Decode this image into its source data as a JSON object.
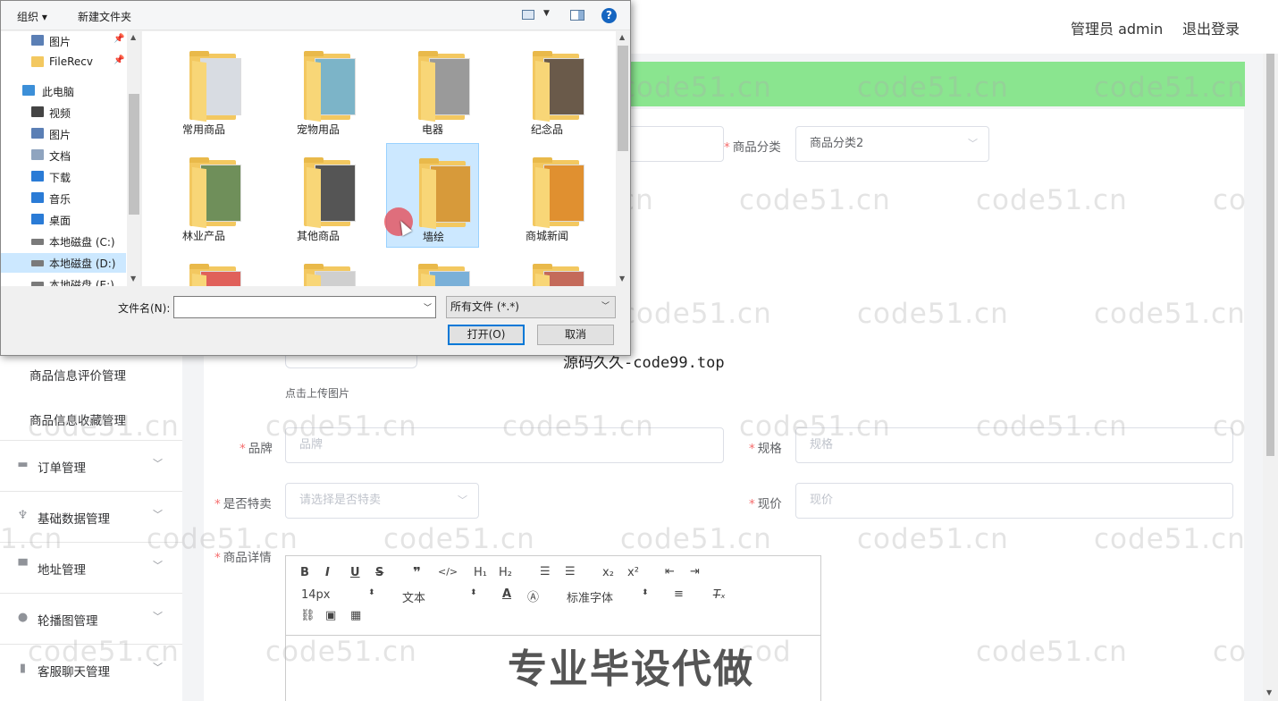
{
  "header": {
    "user": "管理员 admin",
    "logout": "退出登录"
  },
  "sidebar": {
    "sub_items": [
      "商品信息评价管理",
      "商品信息收藏管理"
    ],
    "menus": [
      {
        "label": "订单管理",
        "icon": "cart-icon"
      },
      {
        "label": "基础数据管理",
        "icon": "microphone-icon"
      },
      {
        "label": "地址管理",
        "icon": "pin-icon"
      },
      {
        "label": "轮播图管理",
        "icon": "bulb-icon"
      },
      {
        "label": "客服聊天管理",
        "icon": "phone-icon"
      }
    ]
  },
  "form": {
    "category_label": "商品分类",
    "category_value": "商品分类2",
    "upload_hint": "点击上传图片",
    "brand_label": "品牌",
    "brand_placeholder": "品牌",
    "spec_label": "规格",
    "spec_placeholder": "规格",
    "special_label": "是否特卖",
    "special_placeholder": "请选择是否特卖",
    "price_label": "现价",
    "price_placeholder": "现价",
    "detail_label": "商品详情"
  },
  "editor": {
    "font_size": "14px",
    "block_format": "文本",
    "font_family": "标准字体"
  },
  "dialog": {
    "toolbar": {
      "organize": "组织",
      "new_folder": "新建文件夹",
      "help": "?"
    },
    "nav": [
      {
        "label": "图片",
        "pinned": true,
        "icon": "pictures-icon",
        "color": "#5b7fb5"
      },
      {
        "label": "FileRecv",
        "pinned": true,
        "icon": "folder-icon",
        "color": "#f3c860"
      },
      {
        "label": "此电脑",
        "pinned": false,
        "icon": "computer-icon",
        "color": "#3c8fd8"
      },
      {
        "label": "视频",
        "pinned": false,
        "icon": "video-icon",
        "color": "#444"
      },
      {
        "label": "图片",
        "pinned": false,
        "icon": "pictures-icon",
        "color": "#5b7fb5"
      },
      {
        "label": "文档",
        "pinned": false,
        "icon": "document-icon",
        "color": "#8fa4bf"
      },
      {
        "label": "下载",
        "pinned": false,
        "icon": "download-icon",
        "color": "#2a7bd6"
      },
      {
        "label": "音乐",
        "pinned": false,
        "icon": "music-icon",
        "color": "#2a7bd6"
      },
      {
        "label": "桌面",
        "pinned": false,
        "icon": "desktop-icon",
        "color": "#2a7bd6"
      },
      {
        "label": "本地磁盘 (C:)",
        "pinned": false,
        "icon": "drive-icon",
        "color": "#7a7a7a"
      },
      {
        "label": "本地磁盘 (D:)",
        "pinned": false,
        "icon": "drive-icon",
        "color": "#7a7a7a",
        "selected": true
      },
      {
        "label": "本地磁盘 (E:)",
        "pinned": false,
        "icon": "drive-icon",
        "color": "#7a7a7a"
      }
    ],
    "folders": [
      {
        "label": "常用商品",
        "color": "#d8dce2"
      },
      {
        "label": "宠物用品",
        "color": "#7cb4c8"
      },
      {
        "label": "电器",
        "color": "#9a9a9a"
      },
      {
        "label": "纪念品",
        "color": "#6a5a4a"
      },
      {
        "label": "林业产品",
        "color": "#6f8f5a"
      },
      {
        "label": "其他商品",
        "color": "#555"
      },
      {
        "label": "墙绘",
        "color": "#d79a3a",
        "selected": true
      },
      {
        "label": "商城新闻",
        "color": "#e09030"
      },
      {
        "label": "",
        "color": "#e0605a"
      },
      {
        "label": "",
        "color": "#cfcfcf"
      },
      {
        "label": "",
        "color": "#7ab0d8"
      },
      {
        "label": "",
        "color": "#c46a5a"
      }
    ],
    "filename_label": "文件名(N):",
    "filename_value": "",
    "filetype": "所有文件 (*.*)",
    "open_button": "打开(O)",
    "cancel_button": "取消"
  },
  "watermarks": {
    "site": "code51.cn",
    "cropped": "1.cn",
    "prefix_c": "c",
    "prefix_co": "co",
    "prefix_cod": "cod",
    "stamp": "源码久久-code99.top",
    "banner": "专业毕设代做"
  },
  "colors": {
    "accent_green": "#8ae58f",
    "required": "#f56c6c",
    "dialog_selection": "#cce8ff",
    "dialog_focus": "#0078d7"
  }
}
